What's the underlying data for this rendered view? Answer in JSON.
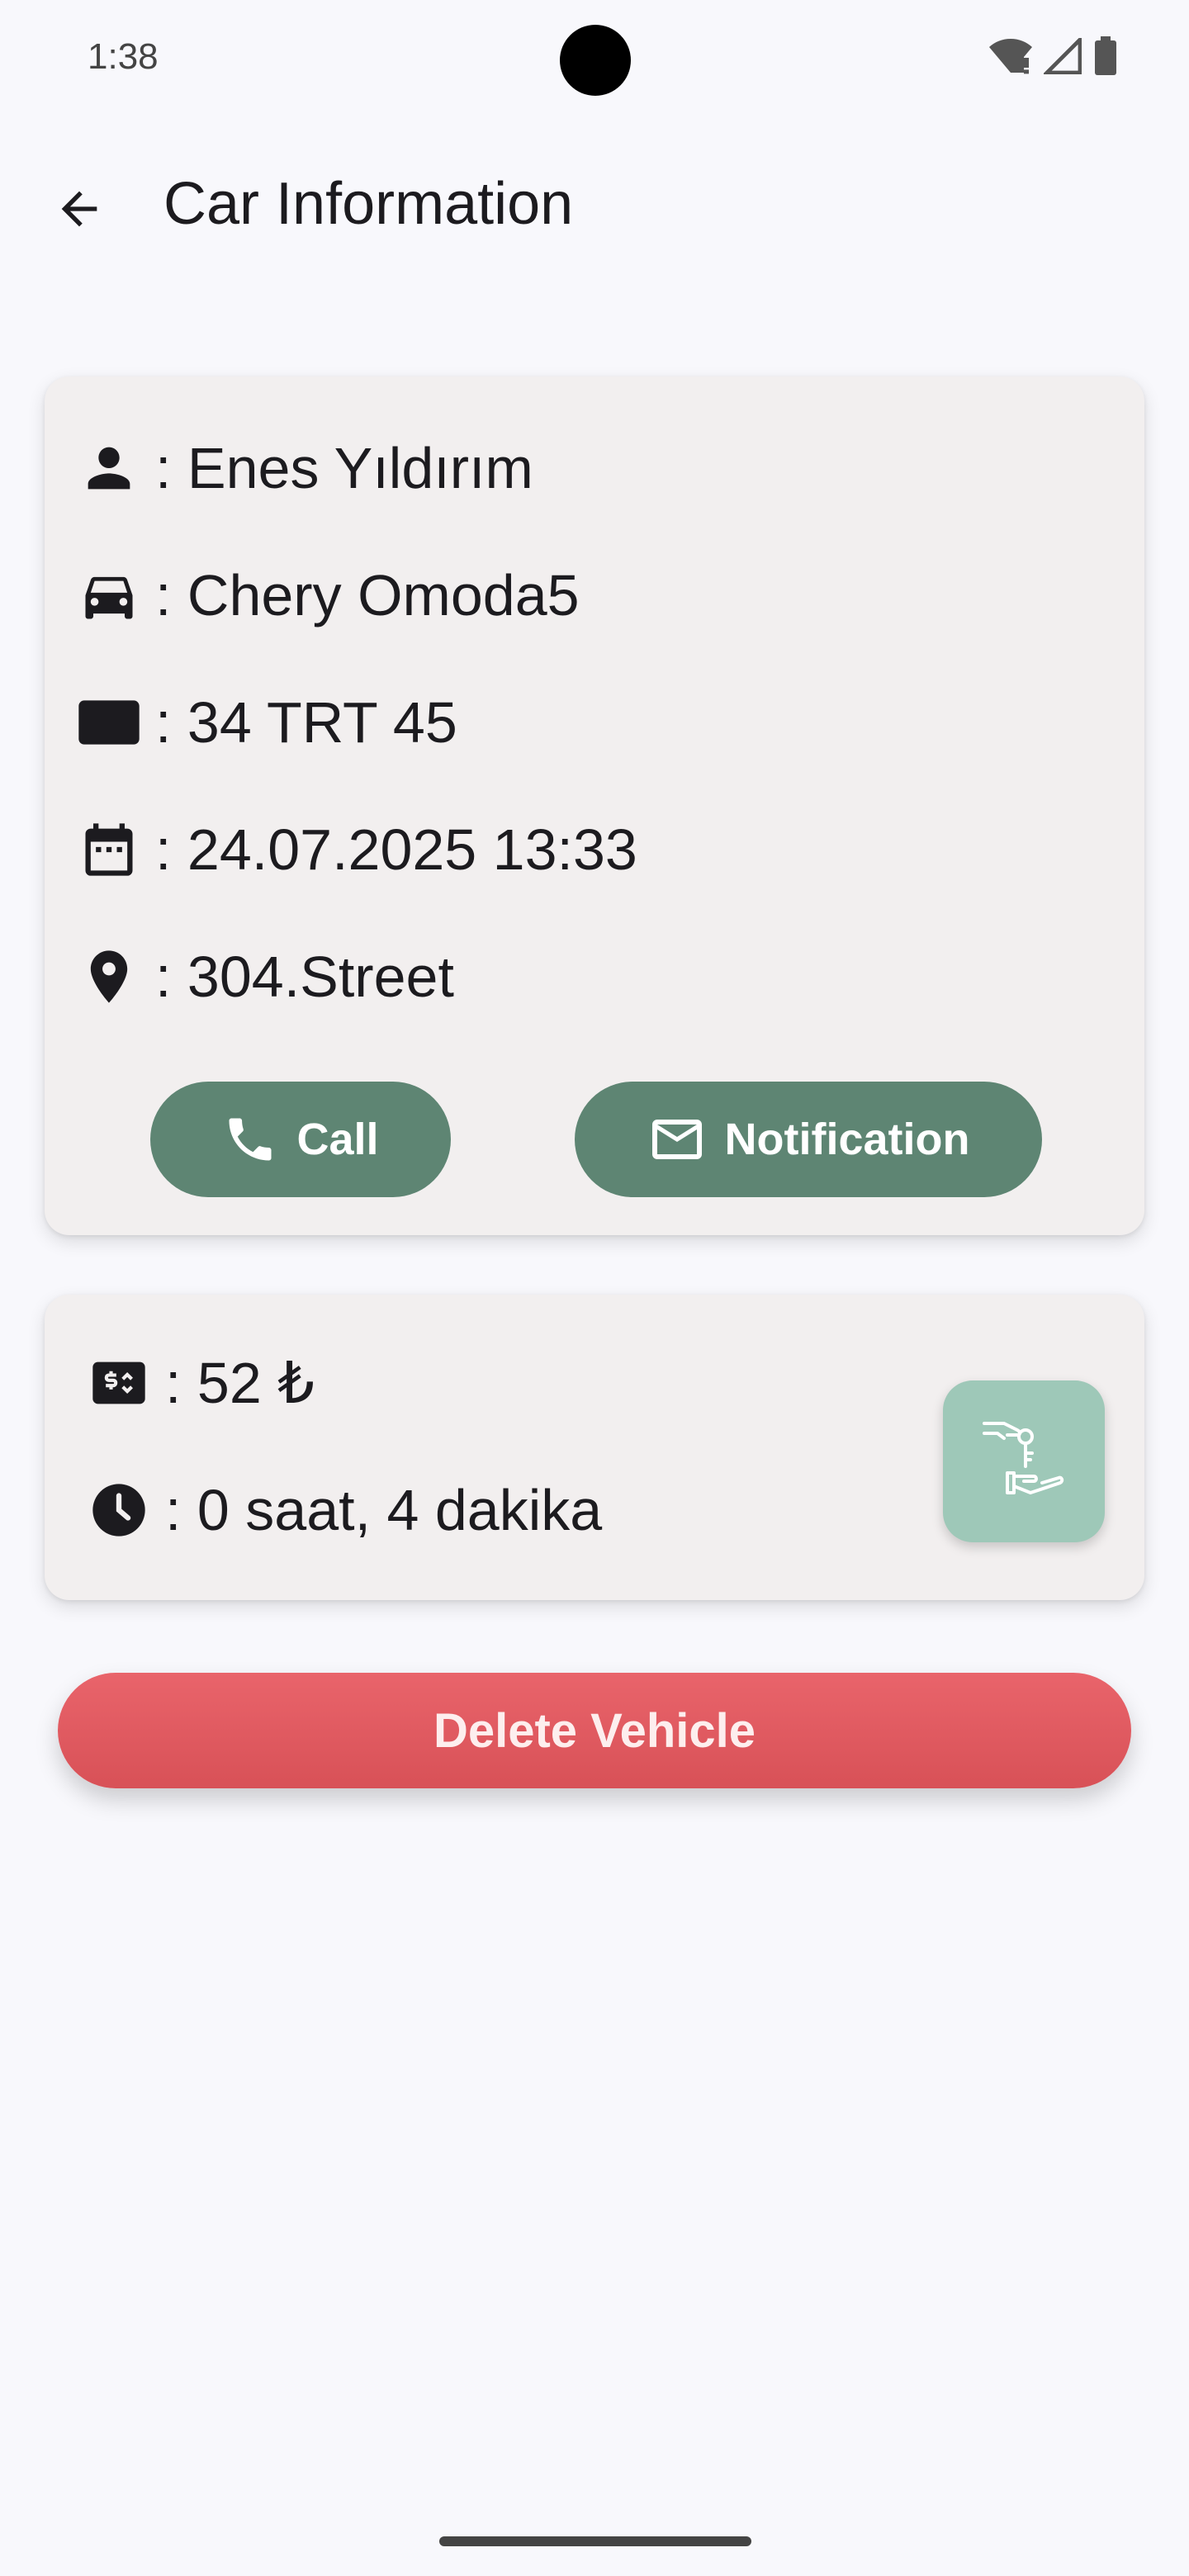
{
  "status_bar": {
    "time": "1:38"
  },
  "app_bar": {
    "title": "Car Information"
  },
  "owner_card": {
    "rows": [
      {
        "icon": "person-icon",
        "text": ": Enes Yıldırım"
      },
      {
        "icon": "car-icon",
        "text": ": Chery Omoda5"
      },
      {
        "icon": "license-plate-icon",
        "text": ": 34 TRT 45"
      },
      {
        "icon": "calendar-icon",
        "text": ": 24.07.2025 13:33"
      },
      {
        "icon": "location-pin-icon",
        "text": ": 304.Street"
      }
    ],
    "call_label": "Call",
    "notification_label": "Notification"
  },
  "fee_card": {
    "price": ": 52 ₺",
    "duration": ": 0 saat, 4 dakika",
    "fab_icon": "hand-over-key-icon"
  },
  "delete_label": "Delete Vehicle",
  "colors": {
    "background": "#f8f8fc",
    "card": "#f2efef",
    "primary_green": "#5e8573",
    "fab_green": "#9ec8b8",
    "danger": "#e05a60"
  }
}
